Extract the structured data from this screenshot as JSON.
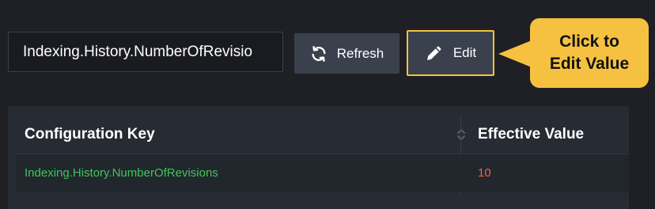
{
  "search": {
    "value": "Indexing.History.NumberOfRevisio"
  },
  "toolbar": {
    "refresh_label": "Refresh",
    "edit_label": "Edit"
  },
  "callout": {
    "line1": "Click to",
    "line2": "Edit Value"
  },
  "table": {
    "headers": [
      "Configuration Key",
      "Effective Value"
    ],
    "rows": [
      {
        "key": "Indexing.History.NumberOfRevisions",
        "value": "10"
      }
    ]
  },
  "colors": {
    "background": "#1f2026",
    "button": "#3a414d",
    "accent": "#f6c140",
    "key_text": "#3fc65c",
    "value_text": "#f26346"
  },
  "icons": {
    "refresh": "refresh-icon",
    "edit": "pencil-icon",
    "sort": "sort-icon"
  }
}
